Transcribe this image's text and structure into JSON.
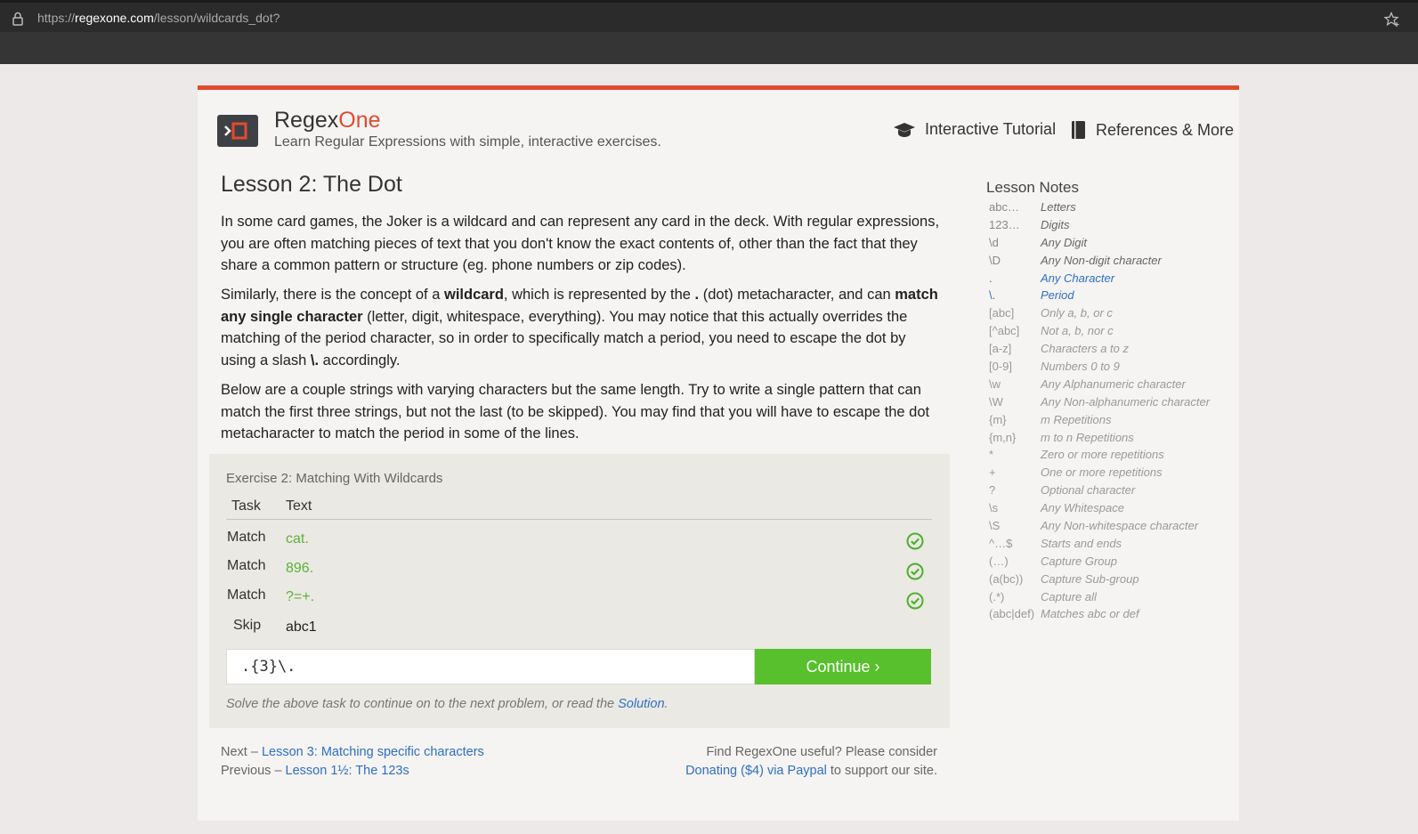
{
  "browser": {
    "url_scheme": "https://",
    "url_host": "regexone.com",
    "url_path": "/lesson/wildcards_dot?"
  },
  "header": {
    "brand_main": "Regex",
    "brand_accent": "One",
    "tagline": "Learn Regular Expressions with simple, interactive exercises.",
    "nav": {
      "tutorial": "Interactive Tutorial",
      "references": "References & More"
    },
    "accent_color": "#e14b2f"
  },
  "lesson": {
    "title": "Lesson 2: The Dot",
    "p1": "In some card games, the Joker is a wildcard and can represent any card in the deck. With regular expressions, you are often matching pieces of text that you don't know the exact contents of, other than the fact that they share a common pattern or structure (eg. phone numbers or zip codes).",
    "p2_a": "Similarly, there is the concept of a ",
    "p2_b": "wildcard",
    "p2_c": ", which is represented by the ",
    "p2_d": ".",
    "p2_e": " (dot) metacharacter, and can ",
    "p2_f": "match any single character",
    "p2_g": " (letter, digit, whitespace, everything). You may notice that this actually overrides the matching of the period character, so in order to specifically match a period, you need to escape the dot by using a slash ",
    "p2_h": "\\.",
    "p2_i": " accordingly.",
    "p3": "Below are a couple strings with varying characters but the same length. Try to write a single pattern that can match the first three strings, but not the last (to be skipped). You may find that you will have to escape the dot metacharacter to match the period in some of the lines."
  },
  "exercise": {
    "title": "Exercise 2: Matching With Wildcards",
    "col_task": "Task",
    "col_text": "Text",
    "rows": [
      {
        "task": "Match",
        "text": "cat.",
        "status": "passed"
      },
      {
        "task": "Match",
        "text": "896.",
        "status": "passed"
      },
      {
        "task": "Match",
        "text": "?=+.",
        "status": "passed"
      },
      {
        "task": "Skip",
        "text": "abc1",
        "status": "none"
      }
    ],
    "input_value": ".{3}\\.",
    "continue_label": "Continue ›",
    "hint_prefix": "Solve the above task to continue on to the next problem, or read the ",
    "hint_link": "Solution",
    "hint_suffix": ".",
    "success_color": "#57c02c"
  },
  "footer": {
    "next_prefix": "Next – ",
    "next_link": "Lesson 3: Matching specific characters",
    "prev_prefix": "Previous – ",
    "prev_link": "Lesson 1½: The 123s",
    "support_line1": "Find RegexOne useful? Please consider",
    "support_link": "Donating ($4) via Paypal",
    "support_suffix": " to support our site."
  },
  "notes": {
    "title": "Lesson Notes",
    "items": [
      {
        "sym": "abc…",
        "desc": "Letters",
        "state": "done"
      },
      {
        "sym": "123…",
        "desc": "Digits",
        "state": "done"
      },
      {
        "sym": "\\d",
        "desc": "Any Digit",
        "state": "done"
      },
      {
        "sym": "\\D",
        "desc": "Any Non-digit character",
        "state": "done"
      },
      {
        "sym": ".",
        "desc": "Any Character",
        "state": "active"
      },
      {
        "sym": "\\.",
        "desc": "Period",
        "state": "active"
      },
      {
        "sym": "[abc]",
        "desc": "Only a, b, or c",
        "state": "todo"
      },
      {
        "sym": "[^abc]",
        "desc": "Not a, b, nor c",
        "state": "todo"
      },
      {
        "sym": "[a-z]",
        "desc": "Characters a to z",
        "state": "todo"
      },
      {
        "sym": "[0-9]",
        "desc": "Numbers 0 to 9",
        "state": "todo"
      },
      {
        "sym": "\\w",
        "desc": "Any Alphanumeric character",
        "state": "todo"
      },
      {
        "sym": "\\W",
        "desc": "Any Non-alphanumeric character",
        "state": "todo"
      },
      {
        "sym": "{m}",
        "desc": "m Repetitions",
        "state": "todo"
      },
      {
        "sym": "{m,n}",
        "desc": "m to n Repetitions",
        "state": "todo"
      },
      {
        "sym": "*",
        "desc": "Zero or more repetitions",
        "state": "todo"
      },
      {
        "sym": "+",
        "desc": "One or more repetitions",
        "state": "todo"
      },
      {
        "sym": "?",
        "desc": "Optional character",
        "state": "todo"
      },
      {
        "sym": "\\s",
        "desc": "Any Whitespace",
        "state": "todo"
      },
      {
        "sym": "\\S",
        "desc": "Any Non-whitespace character",
        "state": "todo"
      },
      {
        "sym": "^…$",
        "desc": "Starts and ends",
        "state": "todo"
      },
      {
        "sym": "(…)",
        "desc": "Capture Group",
        "state": "todo"
      },
      {
        "sym": "(a(bc))",
        "desc": "Capture Sub-group",
        "state": "todo"
      },
      {
        "sym": "(.*)",
        "desc": "Capture all",
        "state": "todo"
      },
      {
        "sym": "(abc|def)",
        "desc": "Matches abc or def",
        "state": "todo"
      }
    ]
  }
}
